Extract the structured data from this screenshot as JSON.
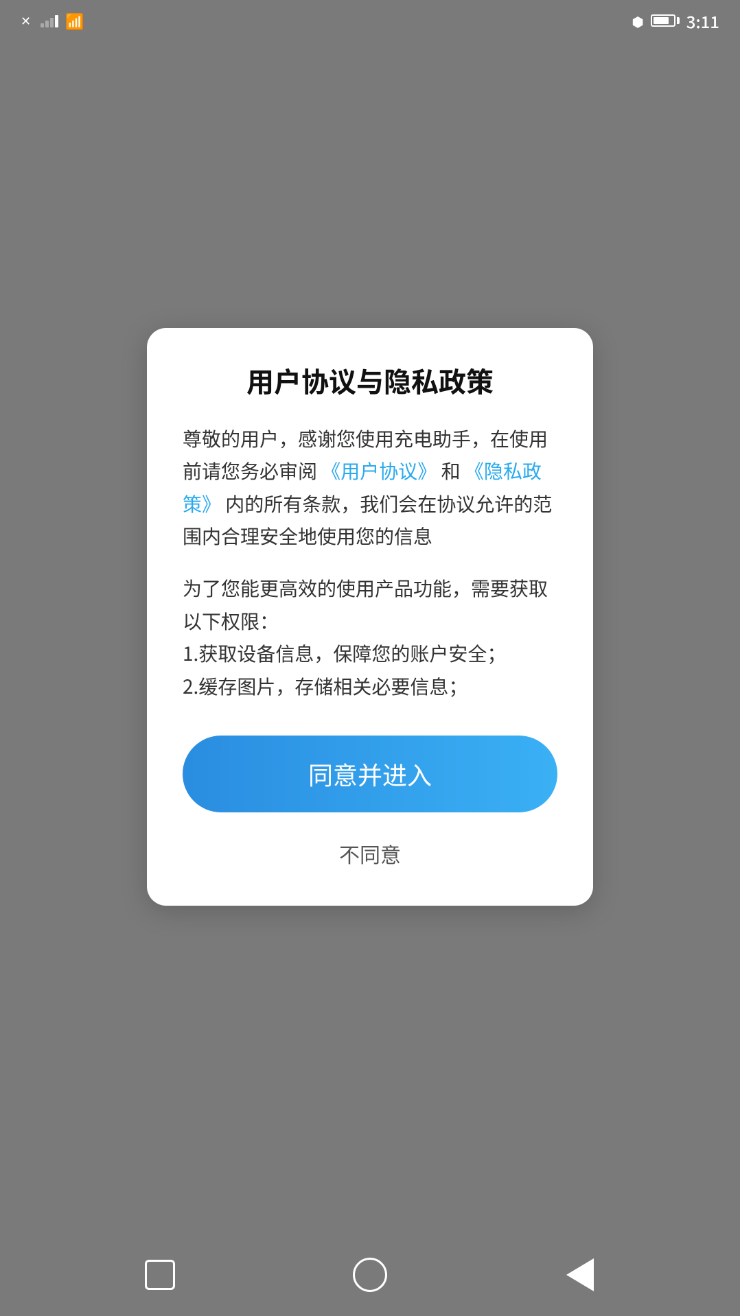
{
  "statusBar": {
    "time": "3:11",
    "signalAlt": "signal",
    "wifiAlt": "wifi",
    "batteryAlt": "battery",
    "bluetoothAlt": "bluetooth"
  },
  "dialog": {
    "title": "用户协议与隐私政策",
    "bodyPart1": "尊敬的用户，感谢您使用充电助手，在使用前请您务必审阅",
    "linkUserAgreement": "《用户协议》",
    "bodyPart2": "和",
    "linkPrivacyPolicy": "《隐私政策》",
    "bodyPart3": "内的所有条款，我们会在协议允许的范围内合理安全地使用您的信息",
    "section2Line1": "为了您能更高效的使用产品功能，需要获取以下权限：",
    "section2Line2": "1.获取设备信息，保障您的账户安全；",
    "section2Line3": "2.缓存图片，存储相关必要信息；",
    "agreeButton": "同意并进入",
    "disagreeButton": "不同意"
  },
  "navBar": {
    "recentAppsAlt": "recent-apps",
    "homeAlt": "home",
    "backAlt": "back"
  }
}
